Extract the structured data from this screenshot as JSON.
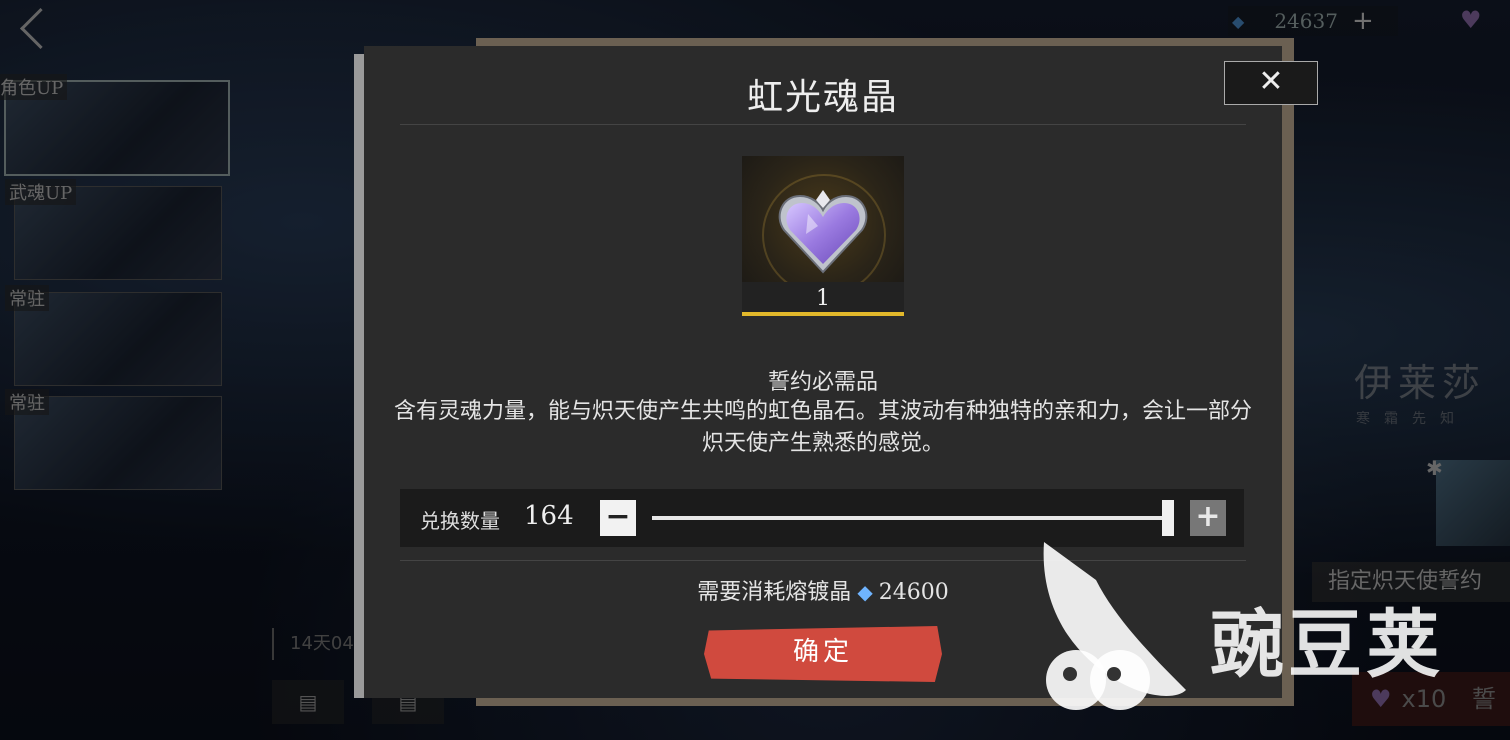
{
  "top_bar": {
    "currency_value": "24637",
    "currency_plus": "+"
  },
  "banners": [
    {
      "tag": "角色UP"
    },
    {
      "tag": "武魂UP"
    },
    {
      "tag": "常驻"
    },
    {
      "tag": "常驻"
    }
  ],
  "left_timer": "14天04",
  "right_panel": {
    "character_name": "伊莱莎",
    "character_subtitle": "寒霜先知",
    "banner_text": "指定炽天使誓约",
    "button_count": "x10",
    "button_tail": "誓"
  },
  "dialog": {
    "title": "虹光魂晶",
    "close_label": "✕",
    "item_count": "1",
    "item_subtitle": "誓约必需品",
    "item_description": "含有灵魂力量，能与炽天使产生共鸣的虹色晶石。其波动有种独特的亲和力，会让一部分炽天使产生熟悉的感觉。",
    "quantity_label": "兑换数量",
    "quantity_value": "164",
    "quantity_fraction": 1.0,
    "minus_label": "−",
    "plus_label": "+",
    "cost_label": "需要消耗熔镀晶",
    "cost_value": "24600",
    "confirm_label": "确定"
  },
  "watermark": {
    "text": "豌豆荚"
  },
  "colors": {
    "confirm": "#d04a3e",
    "item_bar": "#e2b82b",
    "heart": "#a88ce8"
  }
}
